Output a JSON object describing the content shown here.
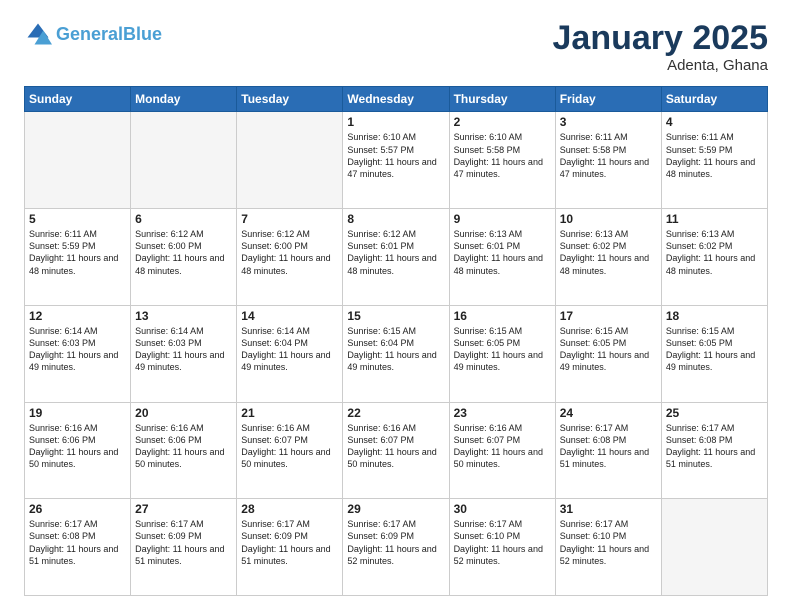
{
  "logo": {
    "general": "General",
    "blue": "Blue"
  },
  "header": {
    "title": "January 2025",
    "location": "Adenta, Ghana"
  },
  "weekdays": [
    "Sunday",
    "Monday",
    "Tuesday",
    "Wednesday",
    "Thursday",
    "Friday",
    "Saturday"
  ],
  "weeks": [
    [
      {
        "day": null
      },
      {
        "day": null
      },
      {
        "day": null
      },
      {
        "day": "1",
        "sunrise": "6:10 AM",
        "sunset": "5:57 PM",
        "daylight": "11 hours and 47 minutes."
      },
      {
        "day": "2",
        "sunrise": "6:10 AM",
        "sunset": "5:58 PM",
        "daylight": "11 hours and 47 minutes."
      },
      {
        "day": "3",
        "sunrise": "6:11 AM",
        "sunset": "5:58 PM",
        "daylight": "11 hours and 47 minutes."
      },
      {
        "day": "4",
        "sunrise": "6:11 AM",
        "sunset": "5:59 PM",
        "daylight": "11 hours and 48 minutes."
      }
    ],
    [
      {
        "day": "5",
        "sunrise": "6:11 AM",
        "sunset": "5:59 PM",
        "daylight": "11 hours and 48 minutes."
      },
      {
        "day": "6",
        "sunrise": "6:12 AM",
        "sunset": "6:00 PM",
        "daylight": "11 hours and 48 minutes."
      },
      {
        "day": "7",
        "sunrise": "6:12 AM",
        "sunset": "6:00 PM",
        "daylight": "11 hours and 48 minutes."
      },
      {
        "day": "8",
        "sunrise": "6:12 AM",
        "sunset": "6:01 PM",
        "daylight": "11 hours and 48 minutes."
      },
      {
        "day": "9",
        "sunrise": "6:13 AM",
        "sunset": "6:01 PM",
        "daylight": "11 hours and 48 minutes."
      },
      {
        "day": "10",
        "sunrise": "6:13 AM",
        "sunset": "6:02 PM",
        "daylight": "11 hours and 48 minutes."
      },
      {
        "day": "11",
        "sunrise": "6:13 AM",
        "sunset": "6:02 PM",
        "daylight": "11 hours and 48 minutes."
      }
    ],
    [
      {
        "day": "12",
        "sunrise": "6:14 AM",
        "sunset": "6:03 PM",
        "daylight": "11 hours and 49 minutes."
      },
      {
        "day": "13",
        "sunrise": "6:14 AM",
        "sunset": "6:03 PM",
        "daylight": "11 hours and 49 minutes."
      },
      {
        "day": "14",
        "sunrise": "6:14 AM",
        "sunset": "6:04 PM",
        "daylight": "11 hours and 49 minutes."
      },
      {
        "day": "15",
        "sunrise": "6:15 AM",
        "sunset": "6:04 PM",
        "daylight": "11 hours and 49 minutes."
      },
      {
        "day": "16",
        "sunrise": "6:15 AM",
        "sunset": "6:05 PM",
        "daylight": "11 hours and 49 minutes."
      },
      {
        "day": "17",
        "sunrise": "6:15 AM",
        "sunset": "6:05 PM",
        "daylight": "11 hours and 49 minutes."
      },
      {
        "day": "18",
        "sunrise": "6:15 AM",
        "sunset": "6:05 PM",
        "daylight": "11 hours and 49 minutes."
      }
    ],
    [
      {
        "day": "19",
        "sunrise": "6:16 AM",
        "sunset": "6:06 PM",
        "daylight": "11 hours and 50 minutes."
      },
      {
        "day": "20",
        "sunrise": "6:16 AM",
        "sunset": "6:06 PM",
        "daylight": "11 hours and 50 minutes."
      },
      {
        "day": "21",
        "sunrise": "6:16 AM",
        "sunset": "6:07 PM",
        "daylight": "11 hours and 50 minutes."
      },
      {
        "day": "22",
        "sunrise": "6:16 AM",
        "sunset": "6:07 PM",
        "daylight": "11 hours and 50 minutes."
      },
      {
        "day": "23",
        "sunrise": "6:16 AM",
        "sunset": "6:07 PM",
        "daylight": "11 hours and 50 minutes."
      },
      {
        "day": "24",
        "sunrise": "6:17 AM",
        "sunset": "6:08 PM",
        "daylight": "11 hours and 51 minutes."
      },
      {
        "day": "25",
        "sunrise": "6:17 AM",
        "sunset": "6:08 PM",
        "daylight": "11 hours and 51 minutes."
      }
    ],
    [
      {
        "day": "26",
        "sunrise": "6:17 AM",
        "sunset": "6:08 PM",
        "daylight": "11 hours and 51 minutes."
      },
      {
        "day": "27",
        "sunrise": "6:17 AM",
        "sunset": "6:09 PM",
        "daylight": "11 hours and 51 minutes."
      },
      {
        "day": "28",
        "sunrise": "6:17 AM",
        "sunset": "6:09 PM",
        "daylight": "11 hours and 51 minutes."
      },
      {
        "day": "29",
        "sunrise": "6:17 AM",
        "sunset": "6:09 PM",
        "daylight": "11 hours and 52 minutes."
      },
      {
        "day": "30",
        "sunrise": "6:17 AM",
        "sunset": "6:10 PM",
        "daylight": "11 hours and 52 minutes."
      },
      {
        "day": "31",
        "sunrise": "6:17 AM",
        "sunset": "6:10 PM",
        "daylight": "11 hours and 52 minutes."
      },
      {
        "day": null
      }
    ]
  ]
}
